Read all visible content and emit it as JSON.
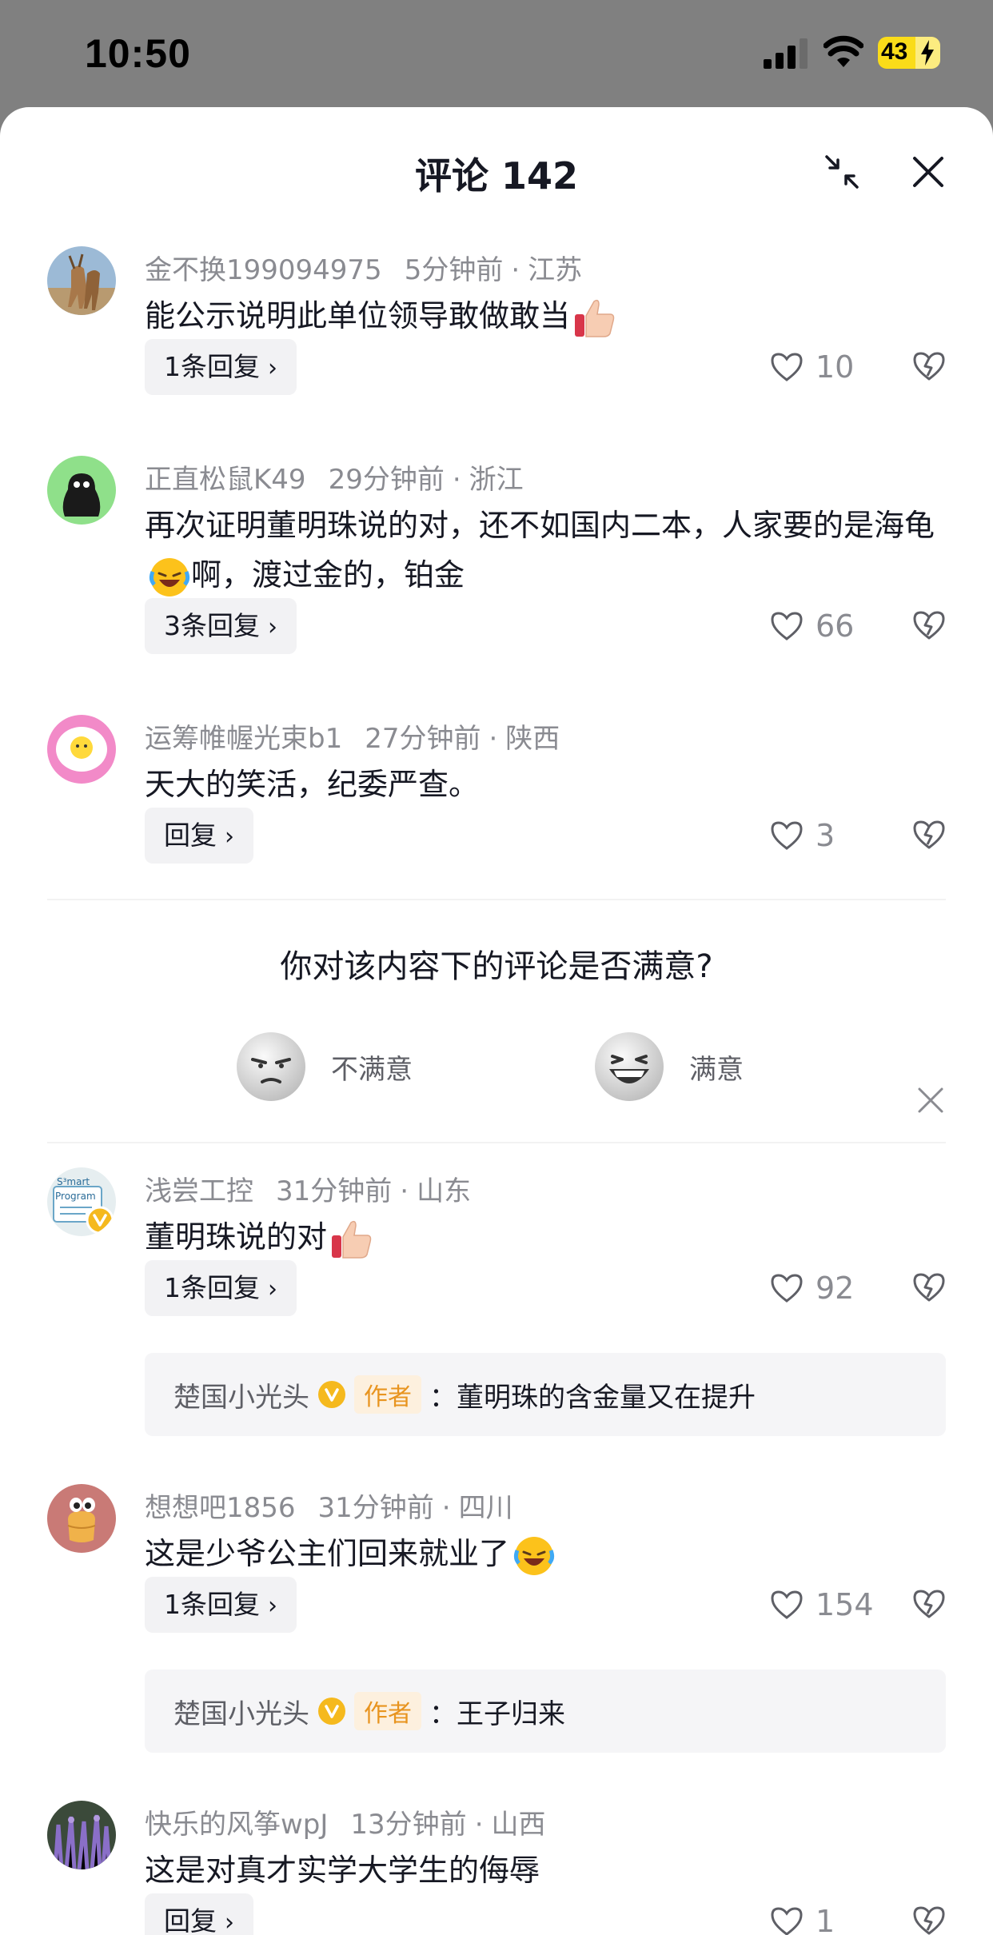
{
  "status": {
    "time": "10:50",
    "battery": "43"
  },
  "sheet": {
    "title": "评论 142"
  },
  "comments": [
    {
      "user": "金不换199094975",
      "time": "5分钟前",
      "location": "江苏",
      "text": "能公示说明此单位领导敢做敢当",
      "text_after": "",
      "emoji": "thumbs-up",
      "replies": "1条回复",
      "likes": "10"
    },
    {
      "user": "正直松鼠K49",
      "time": "29分钟前",
      "location": "浙江",
      "text": "再次证明董明珠说的对，还不如国内二本，人家要的是海龟",
      "text_after": "啊，渡过金的，铂金",
      "emoji": "laughing-tears",
      "replies": "3条回复",
      "likes": "66"
    },
    {
      "user": "运筹帷幄光束b1",
      "time": "27分钟前",
      "location": "陕西",
      "text": "天大的笑活，纪委严查。",
      "text_after": "",
      "emoji": "",
      "replies": "回复",
      "likes": "3"
    },
    {
      "user": "浅尝工控",
      "time": "31分钟前",
      "location": "山东",
      "text": "董明珠说的对",
      "text_after": "",
      "emoji": "thumbs-up",
      "replies": "1条回复",
      "likes": "92",
      "author_reply": {
        "name": "楚国小光头",
        "tag": "作者",
        "text": "董明珠的含金量又在提升"
      }
    },
    {
      "user": "想想吧1856",
      "time": "31分钟前",
      "location": "四川",
      "text": "这是少爷公主们回来就业了",
      "text_after": "",
      "emoji": "laughing-tears",
      "replies": "1条回复",
      "likes": "154",
      "author_reply": {
        "name": "楚国小光头",
        "tag": "作者",
        "text": "王子归来"
      }
    },
    {
      "user": "快乐的风筝wpJ",
      "time": "13分钟前",
      "location": "山西",
      "text": "这是对真才实学大学生的侮辱",
      "text_after": "",
      "emoji": "",
      "replies": "回复",
      "likes": "1"
    }
  ],
  "survey": {
    "question": "你对该内容下的评论是否满意?",
    "option_bad": "不满意",
    "option_good": "满意"
  },
  "sep": "·",
  "chevron": "›",
  "colon": "：",
  "colors": {
    "like_gray": "#8a8b91",
    "author_tag_bg": "#fdf0de",
    "author_tag_text": "#e8941f",
    "battery": "#fadc19"
  }
}
